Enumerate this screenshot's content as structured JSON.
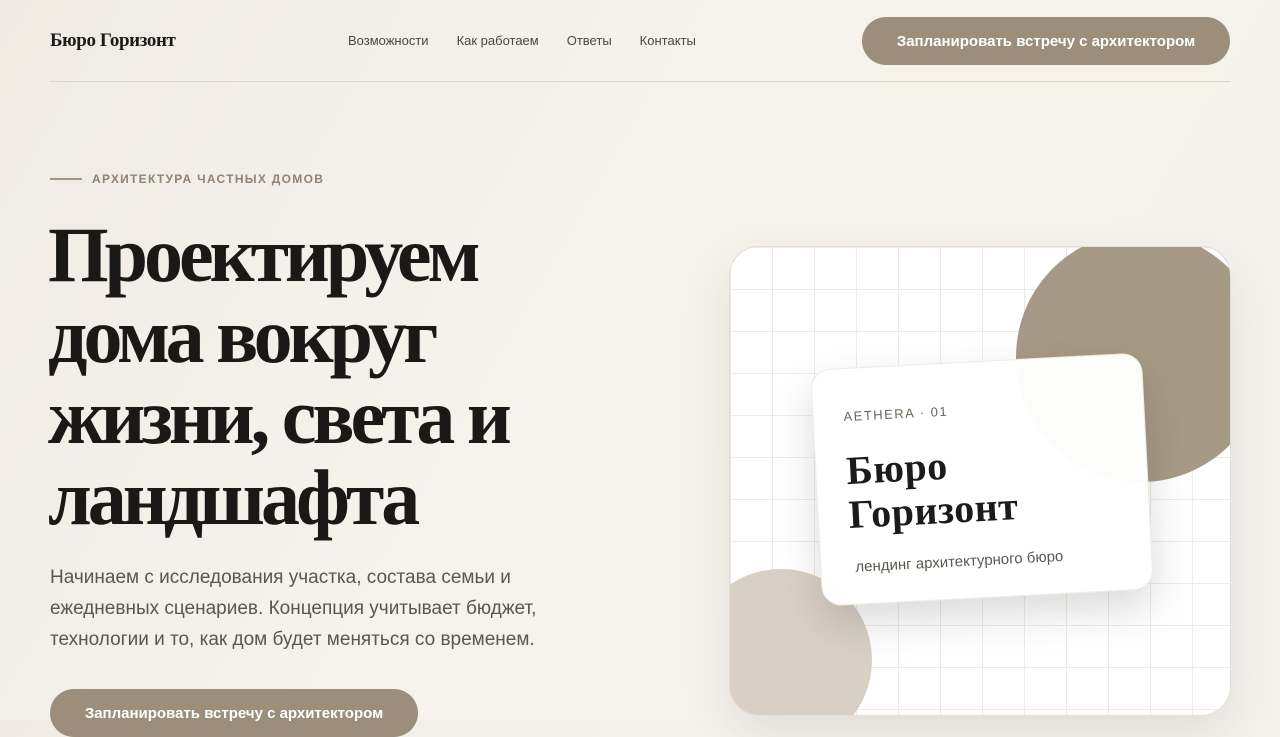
{
  "header": {
    "logo": "Бюро Горизонт",
    "nav": [
      "Возможности",
      "Как работаем",
      "Ответы",
      "Контакты"
    ],
    "cta_label": "Запланировать встречу с архитектором"
  },
  "hero": {
    "eyebrow": "АРХИТЕКТУРА ЧАСТНЫХ ДОМОВ",
    "title_lines": [
      "Проектируем",
      "дома вокруг",
      "жизни, света и",
      "ландшафта"
    ],
    "lead": "Начинаем с исследования участка, состава семьи и ежедневных сценариев. Концепция учитывает бюджет, технологии и то, как дом будет меняться со временем.",
    "cta_label": "Запланировать встречу с архитектором"
  },
  "visual_card": {
    "kicker": "AETHERA · 01",
    "title_lines": [
      "Бюро",
      "Горизонт"
    ],
    "subtitle": "лендинг архитектурного бюро"
  },
  "colors": {
    "accent": "#9c8e7a",
    "circle_dark": "#a69a86",
    "circle_light": "#d8d0c4",
    "background": "#f5f2ec"
  }
}
